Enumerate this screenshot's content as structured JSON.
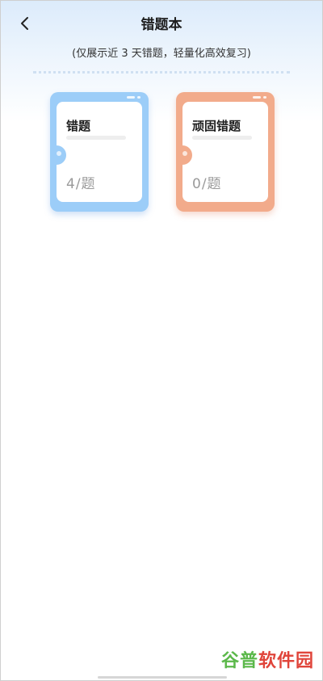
{
  "header": {
    "title": "错题本",
    "subtitle": "(仅展示近 3 天错题，轻量化高效复习)"
  },
  "cards": [
    {
      "name": "错题",
      "count": "4/题",
      "color": "#9ccdf8"
    },
    {
      "name": "顽固错题",
      "count": "0/题",
      "color": "#f2ab8b"
    }
  ],
  "watermark": {
    "part1": "谷普",
    "part2": "软件园"
  },
  "icons": {
    "back": "chevron-left-icon"
  }
}
